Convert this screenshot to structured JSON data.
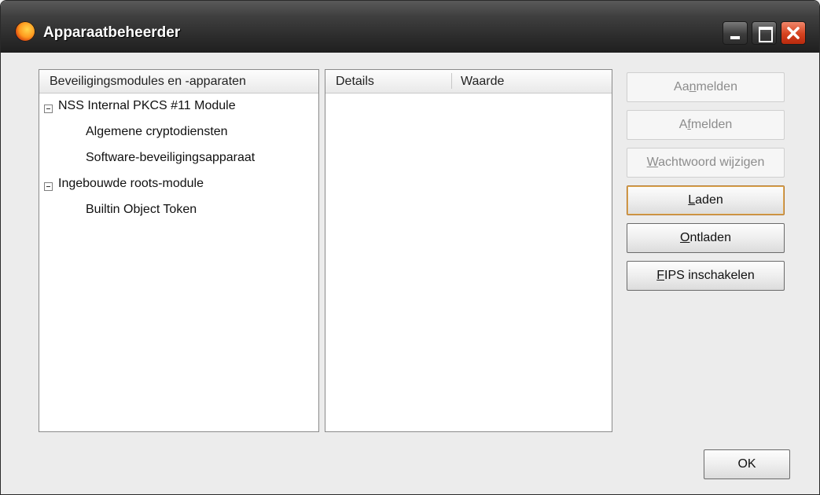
{
  "window": {
    "title": "Apparaatbeheerder",
    "controls": [
      "minimize",
      "maximize",
      "close"
    ]
  },
  "tree": {
    "header": "Beveiligingsmodules en -apparaten",
    "items": [
      {
        "label": "NSS Internal PKCS #11 Module",
        "expanded": true,
        "level": 0
      },
      {
        "label": "Algemene cryptodiensten",
        "level": 1
      },
      {
        "label": "Software-beveiligingsapparaat",
        "level": 1
      },
      {
        "label": "Ingebouwde roots-module",
        "expanded": true,
        "level": 0
      },
      {
        "label": "Builtin Object Token",
        "level": 1
      }
    ]
  },
  "details": {
    "columns": [
      "Details",
      "Waarde"
    ]
  },
  "buttons": {
    "aanmelden": {
      "pre": "Aa",
      "accel": "n",
      "post": "melden",
      "enabled": false
    },
    "afmelden": {
      "pre": "A",
      "accel": "f",
      "post": "melden",
      "enabled": false
    },
    "wachtwoord": {
      "pre": "",
      "accel": "W",
      "post": "achtwoord wijzigen",
      "enabled": false
    },
    "laden": {
      "pre": "",
      "accel": "L",
      "post": "aden",
      "enabled": true,
      "focused": true
    },
    "ontladen": {
      "pre": "",
      "accel": "O",
      "post": "ntladen",
      "enabled": true
    },
    "fips": {
      "pre": "",
      "accel": "F",
      "post": "IPS inschakelen",
      "enabled": true
    },
    "ok": "OK"
  }
}
